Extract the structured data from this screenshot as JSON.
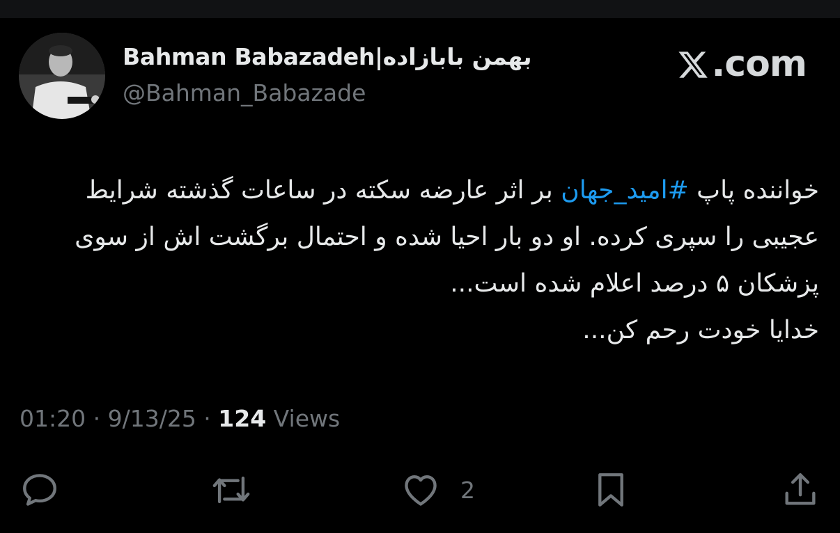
{
  "author": {
    "display_name": "Bahman Babazadeh|بهمن بابازاده",
    "handle": "@Bahman_Babazade"
  },
  "brand": {
    "site": ".com"
  },
  "tweet": {
    "text_before_hashtag": "خواننده پاپ ",
    "hashtag": "#امید_جهان",
    "text_after_hashtag": " بر اثر عارضه سکته در ساعات گذشته شرایط عجیبی را سپری کرده. او دو بار احیا شده و احتمال برگشت اش از سوی پزشکان ۵ درصد اعلام شده است...",
    "text_last_line": "خدایا خودت رحم کن..."
  },
  "meta": {
    "time": "01:20",
    "separator1": " · ",
    "date": "9/13/25",
    "separator2": " · ",
    "views_count": "124",
    "views_label": " Views"
  },
  "actions": {
    "like_count": "2",
    "icons": [
      "reply-icon",
      "retweet-icon",
      "like-icon",
      "bookmark-icon",
      "share-icon"
    ]
  },
  "colors": {
    "background": "#000000",
    "primary_text": "#e7e9ea",
    "secondary_text": "#71767b",
    "hashtag": "#1d9bf0"
  }
}
